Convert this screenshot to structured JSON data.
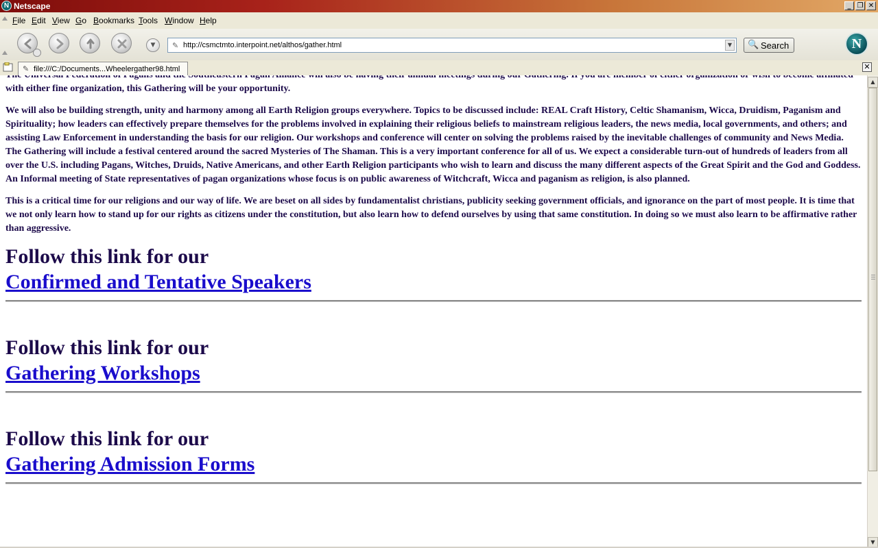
{
  "window": {
    "title": "Netscape",
    "app_icon_letter": "N",
    "buttons": {
      "minimize": "_",
      "maximize": "❐",
      "close": "✕"
    }
  },
  "menubar": {
    "items": [
      "File",
      "Edit",
      "View",
      "Go",
      "Bookmarks",
      "Tools",
      "Window",
      "Help"
    ]
  },
  "navbar": {
    "url": "http://csmctmto.interpoint.net/althos/gather.html",
    "search_label": "Search",
    "logo_letter": "N"
  },
  "tabs": {
    "active_label": "file:///C:/Documents...Wheelergather98.html"
  },
  "page": {
    "paragraphs": [
      "The Universal Federation of Pagans and the Southeastern Pagan Alliance will also be having their annual meetings during our Gathering. If you are member of either organization or wish to become affiliated with either fine organization, this Gathering will be your opportunity.",
      "We will also be building strength, unity and harmony among all Earth Religion groups everywhere. Topics to be discussed include: REAL Craft History, Celtic Shamanism, Wicca, Druidism, Paganism and Spirituality; how leaders can effectively prepare themselves for the problems involved in explaining their religious beliefs to mainstream religious leaders, the news media, local governments, and others; and assisting Law Enforcement in understanding the basis for our religion. Our workshops and conference will center on solving the problems raised by the inevitable challenges of community and News Media. The Gathering will include a festival centered around the sacred Mysteries of The Shaman. This is a very important conference for all of us. We expect a considerable turn-out of hundreds of leaders from all over the U.S. including Pagans, Witches, Druids, Native Americans, and other Earth Religion participants who wish to learn and discuss the many different aspects of the Great Spirit and the God and Goddess. An Informal meeting of State representatives of pagan organizations whose focus is on public awareness of Witchcraft, Wicca and paganism as religion, is also planned.",
      "This is a critical time for our religions and our way of life. We are beset on all sides by fundamentalist christians, publicity seeking government officials, and ignorance on the part of most people. It is time that we not only learn how to stand up for our rights as citizens under the constitution, but also learn how to defend ourselves by using that same constitution. In doing so we must also learn to be affirmative rather than aggressive."
    ],
    "follow_text": "Follow this link for our",
    "links": [
      {
        "label": "Confirmed and Tentative Speakers"
      },
      {
        "label": "Gathering Workshops"
      },
      {
        "label": "Gathering Admission Forms"
      }
    ]
  }
}
